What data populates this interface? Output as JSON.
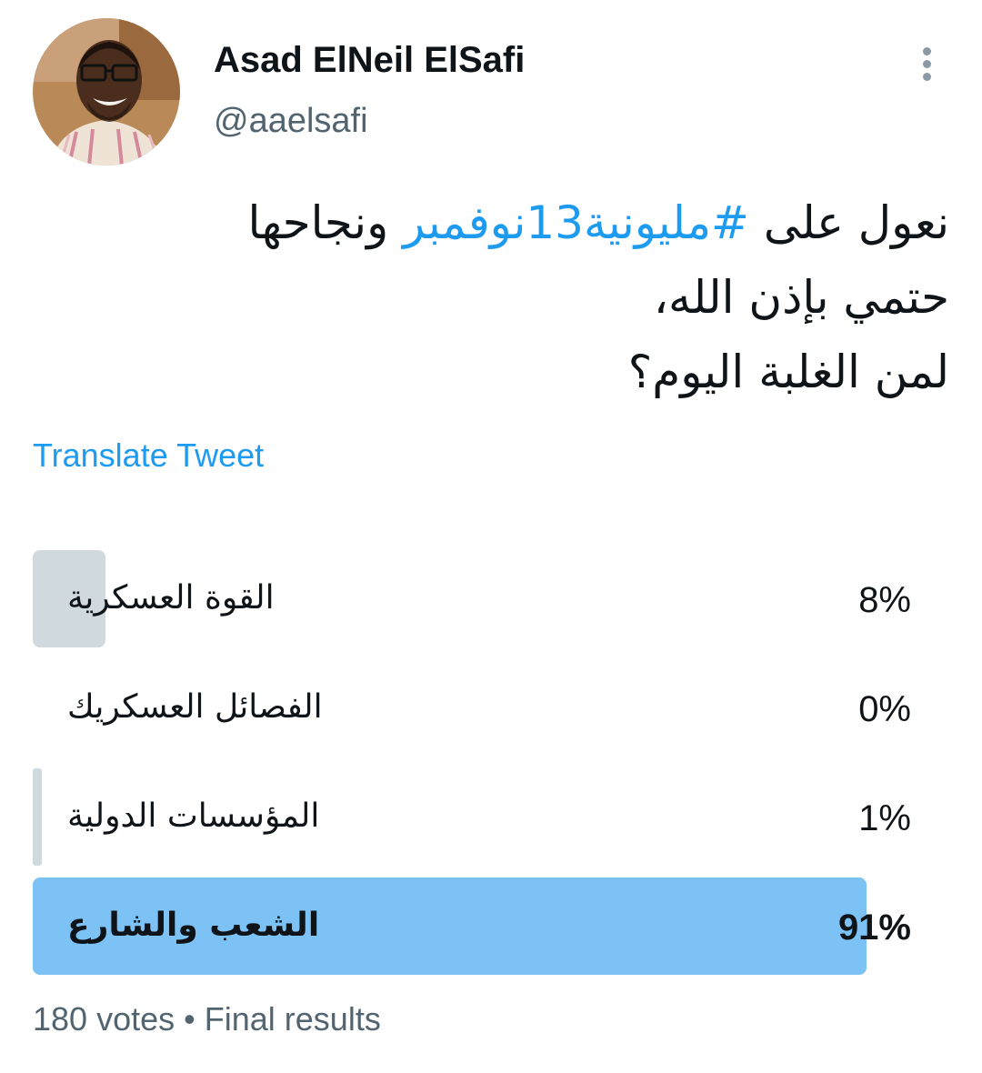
{
  "author": {
    "display_name": "Asad ElNeil ElSafi",
    "handle": "@aaelsafi"
  },
  "tweet": {
    "line1_before": "نعول على ",
    "hashtag": "#مليونية13نوفمبر",
    "line1_after": " ونجاحها",
    "line2": "حتمي بإذن الله،",
    "line3": "لمن الغلبة اليوم؟"
  },
  "translate_label": "Translate Tweet",
  "poll": {
    "options": [
      {
        "label": "القوة العسكرية",
        "percent_text": "8%",
        "share": 0.08
      },
      {
        "label": "الفصائل العسكريك",
        "percent_text": "0%",
        "share": 0.0
      },
      {
        "label": "المؤسسات الدولية",
        "percent_text": "1%",
        "share": 0.01
      },
      {
        "label": "الشعب والشارع",
        "percent_text": "91%",
        "share": 0.91
      }
    ],
    "votes": "180 votes",
    "separator": "•",
    "status": "Final results"
  },
  "colors": {
    "hashtag": "#1d9bf0",
    "translate_link": "#1d9bf0",
    "poll_bar": "#cfd9de",
    "poll_bar_winner": "#7cc2f5",
    "secondary_text": "#536471"
  },
  "icons": {
    "more": "vertical-ellipsis-icon"
  }
}
